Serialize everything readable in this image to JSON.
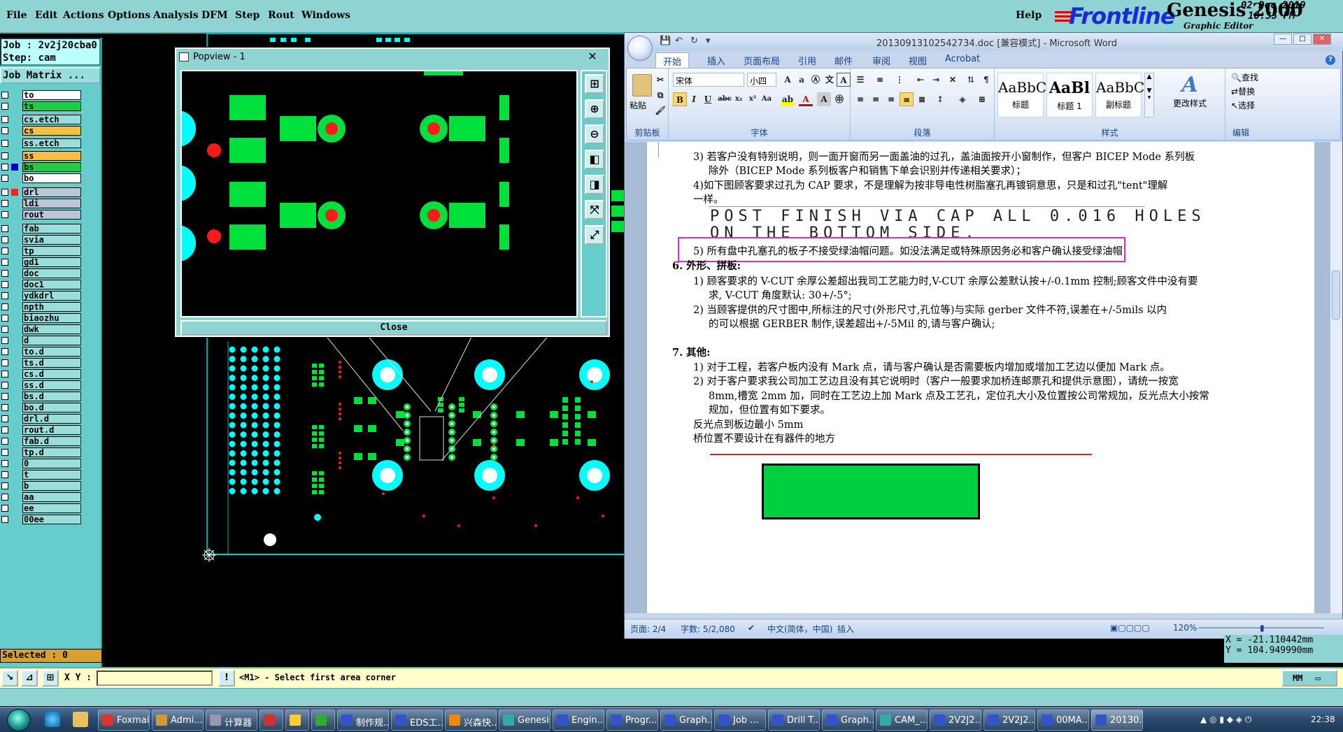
{
  "genesis": {
    "menu": [
      "File",
      "Edit",
      "Actions",
      "Options",
      "Analysis",
      "DFM",
      "Step",
      "Rout",
      "Windows"
    ],
    "help": "Help",
    "brand": "Frontline",
    "title": "Genesis 2000",
    "subtitle": "Graphic Editor",
    "date": "02 Dec 2019",
    "time": "10:35 PM"
  },
  "left": {
    "job": "Job : 2v2j20cba0",
    "step": "Step: cam",
    "job_matrix": "Job Matrix ...",
    "selected": "Selected : 0",
    "layers": [
      {
        "name": "to",
        "bg": "#ffffff",
        "box": "",
        "sel": false
      },
      {
        "name": "ts",
        "bg": "#22cc44",
        "box": "",
        "sel": false
      },
      {
        "name": "cs.etch",
        "bg": "#99dddd",
        "box": "",
        "sel": false
      },
      {
        "name": "cs",
        "bg": "#f5c040",
        "box": "",
        "sel": false
      },
      {
        "name": "ss.etch",
        "bg": "#99dddd",
        "box": "",
        "sel": false
      },
      {
        "name": "ss",
        "bg": "#f5c040",
        "box": "",
        "sel": false
      },
      {
        "name": "bs",
        "bg": "#22cc44",
        "box": "#0000cc",
        "sel": true
      },
      {
        "name": "bo",
        "bg": "#ffffff",
        "box": "",
        "sel": false
      },
      {
        "name": "drl",
        "bg": "#b8c8d8",
        "box": "#ff2020",
        "sel": false
      },
      {
        "name": "ldi",
        "bg": "#b8c8d8",
        "box": "",
        "sel": false
      },
      {
        "name": "rout",
        "bg": "#b8c8d8",
        "box": "",
        "sel": false
      },
      {
        "name": "fab",
        "bg": "#99dddd",
        "box": "",
        "sel": false
      },
      {
        "name": "svia",
        "bg": "#99dddd",
        "box": "",
        "sel": false
      },
      {
        "name": "tp",
        "bg": "#99dddd",
        "box": "",
        "sel": false
      },
      {
        "name": "gd1",
        "bg": "#99dddd",
        "box": "",
        "sel": false
      },
      {
        "name": "doc",
        "bg": "#99dddd",
        "box": "",
        "sel": false
      },
      {
        "name": "doc1",
        "bg": "#99dddd",
        "box": "",
        "sel": false
      },
      {
        "name": "ydkdrl",
        "bg": "#99dddd",
        "box": "",
        "sel": false
      },
      {
        "name": "npth",
        "bg": "#99dddd",
        "box": "",
        "sel": false
      },
      {
        "name": "biaozhu",
        "bg": "#99dddd",
        "box": "",
        "sel": false
      },
      {
        "name": "dwk",
        "bg": "#99dddd",
        "box": "",
        "sel": false
      },
      {
        "name": "d",
        "bg": "#99dddd",
        "box": "",
        "sel": false
      },
      {
        "name": "to.d",
        "bg": "#99dddd",
        "box": "",
        "sel": false
      },
      {
        "name": "ts.d",
        "bg": "#99dddd",
        "box": "",
        "sel": false
      },
      {
        "name": "cs.d",
        "bg": "#99dddd",
        "box": "",
        "sel": false
      },
      {
        "name": "ss.d",
        "bg": "#99dddd",
        "box": "",
        "sel": false
      },
      {
        "name": "bs.d",
        "bg": "#99dddd",
        "box": "",
        "sel": false
      },
      {
        "name": "bo.d",
        "bg": "#99dddd",
        "box": "",
        "sel": false
      },
      {
        "name": "drl.d",
        "bg": "#99dddd",
        "box": "",
        "sel": false
      },
      {
        "name": "rout.d",
        "bg": "#99dddd",
        "box": "",
        "sel": false
      },
      {
        "name": "fab.d",
        "bg": "#99dddd",
        "box": "",
        "sel": false
      },
      {
        "name": "tp.d",
        "bg": "#99dddd",
        "box": "",
        "sel": false
      },
      {
        "name": "0",
        "bg": "#99dddd",
        "box": "",
        "sel": false
      },
      {
        "name": "t",
        "bg": "#99dddd",
        "box": "",
        "sel": false
      },
      {
        "name": "b",
        "bg": "#99dddd",
        "box": "",
        "sel": false
      },
      {
        "name": "aa",
        "bg": "#99dddd",
        "box": "",
        "sel": false
      },
      {
        "name": "ee",
        "bg": "#99dddd",
        "box": "",
        "sel": false
      },
      {
        "name": "00ee",
        "bg": "#99dddd",
        "box": "",
        "sel": false
      }
    ]
  },
  "popview": {
    "title": "Popview - 1",
    "close_x": "✕",
    "close_button": "Close"
  },
  "word": {
    "title": "20130913102542734.doc [兼容模式] - Microsoft Word",
    "tabs": [
      "开始",
      "插入",
      "页面布局",
      "引用",
      "邮件",
      "审阅",
      "视图",
      "Acrobat"
    ],
    "ribbon": {
      "clipboard_label": "剪贴板",
      "paste": "粘贴",
      "font_label": "字体",
      "font_name": "宋体",
      "font_size": "小四",
      "paragraph_label": "段落",
      "styles_label": "样式",
      "styles": [
        {
          "sample": "AaBbC",
          "name": "标题"
        },
        {
          "sample": "AaBl",
          "name": "标题 1"
        },
        {
          "sample": "AaBbC",
          "name": "副标题"
        }
      ],
      "change_styles": "更改样式",
      "editing_label": "编辑",
      "find": "查找",
      "replace": "替换",
      "select": "选择"
    },
    "doc": {
      "p3a": "3) 若客户没有特别说明，则一面开窗而另一面盖油的过孔，盖油面按开小窗制作，但客户 BICEP Mode 系列板",
      "p3b": "除外（BICEP Mode 系列板客户和销售下单会识别并传递相关要求）；",
      "p4a": "4)如下图顾客要求过孔为 CAP 要求，不是理解为按非导电性树脂塞孔再镀铜意思，只是和过孔\"tent\"理解",
      "p4b": "一样。",
      "note1": "POST FINISH VIA CAP ALL 0.016 HOLES",
      "note2": "ON THE BOTTOM SIDE.",
      "p5": "5) 所有盘中孔塞孔的板子不接受绿油帽问题。如没法满足或特殊原因务必和客户确认接受绿油帽",
      "h6": "6.  外形、拼板:",
      "s1a": "1) 顾客要求的 V-CUT 余厚公差超出我司工艺能力时,V-CUT 余厚公差默认按+/-0.1mm 控制;顾客文件中没有要",
      "s1b": "求, V-CUT 角度默认: 30+/-5°;",
      "s2a": "2) 当顾客提供的尺寸图中,所标注的尺寸(外形尺寸,孔位等)与实际 gerber 文件不符,误差在+/-5mils 以内",
      "s2b": "的可以根据 GERBER 制作,误差超出+/-5Mil 的,请与客户确认;",
      "h7": "7.  其他:",
      "o1": "1) 对于工程，若客户板内没有 Mark 点，请与客户确认是否需要板内增加或增加工艺边以便加 Mark 点。",
      "o2a": "2) 对于客户要求我公司加工艺边且没有其它说明时（客户一般要求加桥连邮票孔和提供示意图），请统一按宽",
      "o2b": "8mm,槽宽 2mm 加，同时在工艺边上加 Mark 点及工艺孔，定位孔大小及位置按公司常规加，反光点大小按常",
      "o2c": "规加，但位置有如下要求。",
      "o3": "反光点到板边最小 5mm",
      "o4": "桥位置不要设计在有器件的地方"
    },
    "status": {
      "page": "页面: 2/4",
      "words": "字数: 5/2,080",
      "lang": "中文(简体，中国)",
      "insert": "插入",
      "zoom": "120%"
    }
  },
  "coords": {
    "x": "X = -21.110442mm",
    "y": "Y = 104.949990mm"
  },
  "prompt": {
    "xy_label": "X Y :",
    "xy_value": "",
    "message": "<M1> - Select first area corner",
    "mm": "MM"
  },
  "taskbar": {
    "items": [
      {
        "label": "Foxmail",
        "color": "#d33"
      },
      {
        "label": "Admi...",
        "color": "#c93"
      },
      {
        "label": "计算器",
        "color": "#99a"
      },
      {
        "label": "",
        "color": "#c33"
      },
      {
        "label": "",
        "color": "#fc3"
      },
      {
        "label": "",
        "color": "#3a3"
      },
      {
        "label": "制作规...",
        "color": "#35c"
      },
      {
        "label": "EDS工...",
        "color": "#35c"
      },
      {
        "label": "兴森快...",
        "color": "#e80"
      },
      {
        "label": "Genesis",
        "color": "#3aa"
      },
      {
        "label": "Engin...",
        "color": "#35c"
      },
      {
        "label": "Progr...",
        "color": "#35c"
      },
      {
        "label": "Graph...",
        "color": "#35c"
      },
      {
        "label": "Job ...",
        "color": "#35c"
      },
      {
        "label": "Drill T...",
        "color": "#35c"
      },
      {
        "label": "Graph...",
        "color": "#35c"
      },
      {
        "label": "CAM_...",
        "color": "#3aa"
      },
      {
        "label": "2V2J2...",
        "color": "#35c"
      },
      {
        "label": "2V2J2...",
        "color": "#35c"
      },
      {
        "label": "00MA...",
        "color": "#35c"
      },
      {
        "label": "20130...",
        "color": "#35c"
      }
    ],
    "clock": "22:38"
  },
  "colors": {
    "pad_green": "#00e03c",
    "drill_red": "#ff1a1a",
    "via_cyan": "#00ffff",
    "genesis_bg": "#8fd3d3",
    "highlight_magenta": "#cc33cc"
  }
}
